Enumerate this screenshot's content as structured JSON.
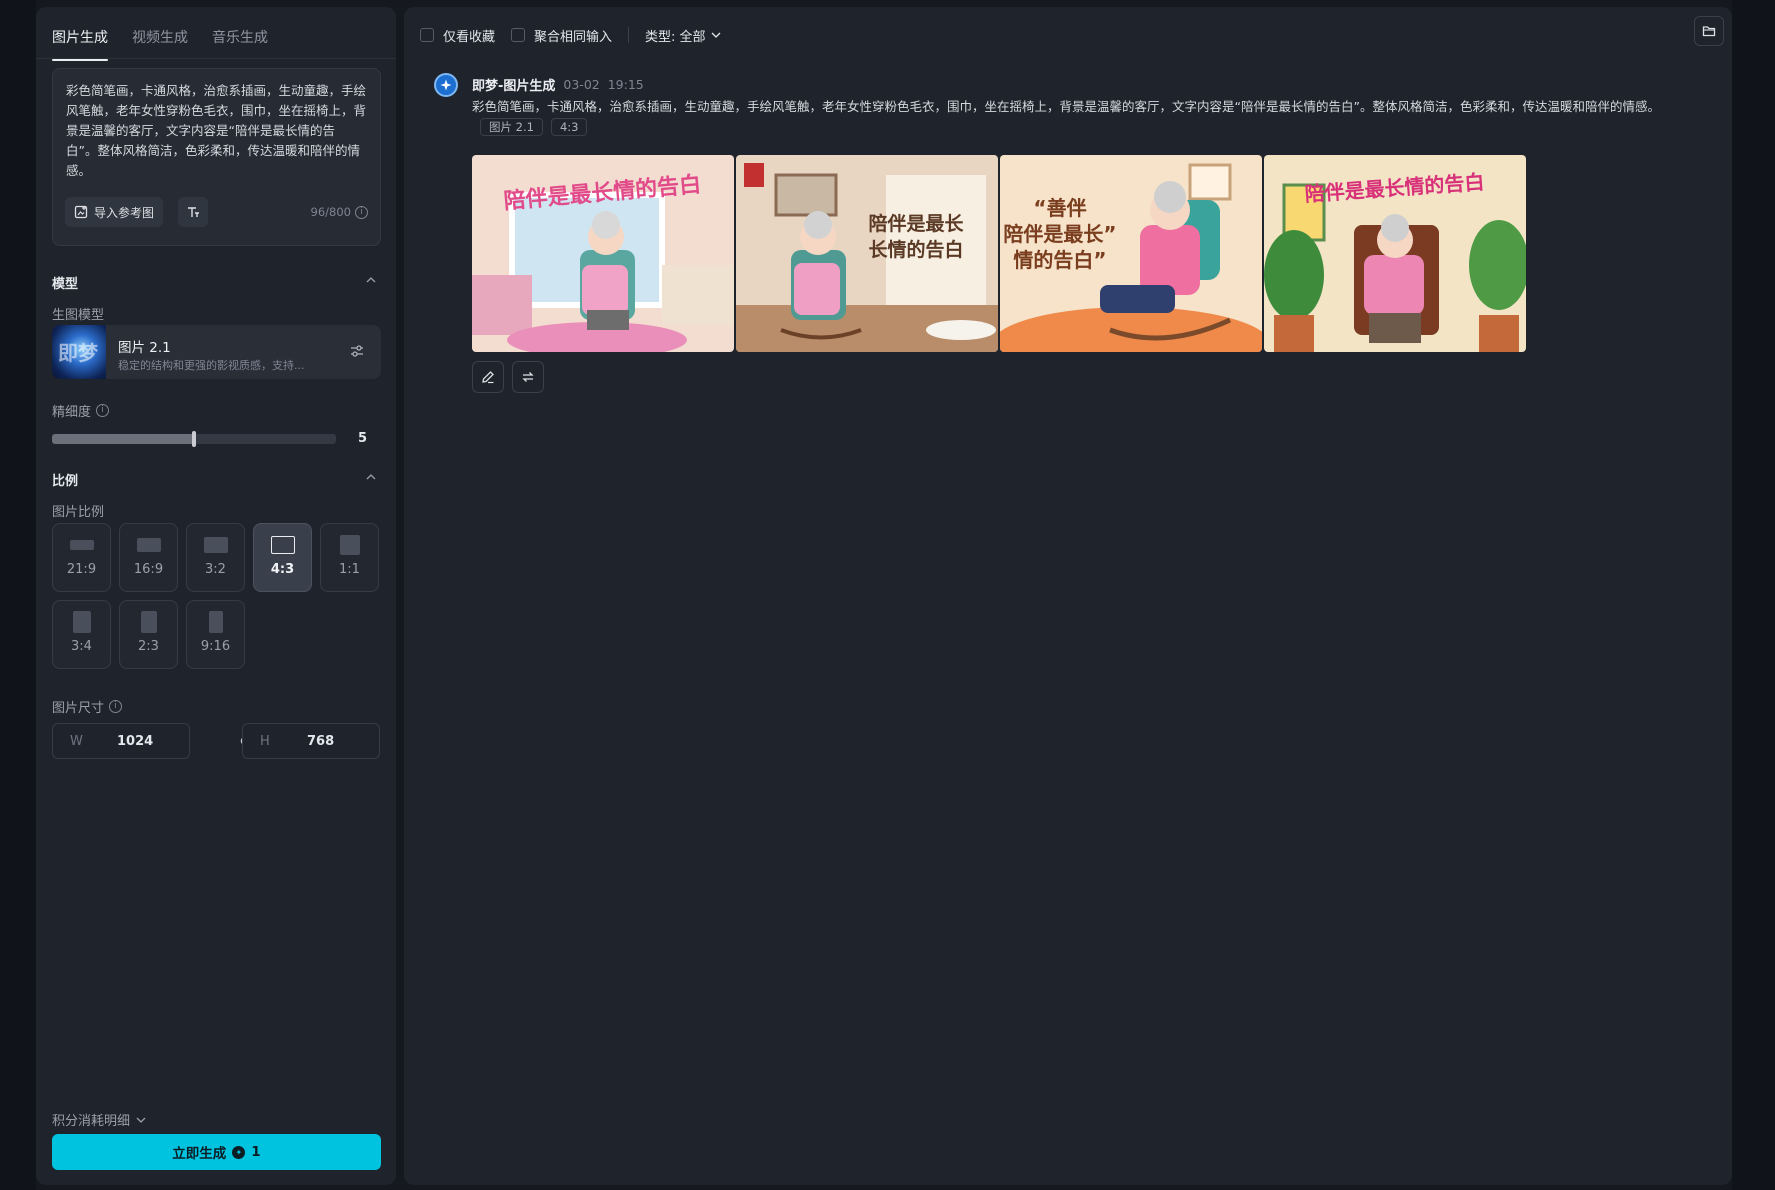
{
  "tabs": [
    {
      "label": "图片生成",
      "active": true
    },
    {
      "label": "视频生成",
      "active": false
    },
    {
      "label": "音乐生成",
      "active": false
    }
  ],
  "prompt": {
    "text": "彩色简笔画，卡通风格，治愈系插画，生动童趣，手绘风笔触，老年女性穿粉色毛衣，围巾，坐在摇椅上，背景是温馨的客厅，文字内容是“陪伴是最长情的告白”。整体风格简洁，色彩柔和，传达温暖和陪伴的情感。",
    "import_ref_label": "导入参考图",
    "char_count": "96/800"
  },
  "model_section": {
    "title": "模型",
    "sub_label": "生图模型",
    "model_name": "图片 2.1",
    "model_desc": "稳定的结构和更强的影视质感，支持...",
    "thumb_text": "即梦"
  },
  "fineness": {
    "label": "精细度",
    "value": "5",
    "level": 0.5
  },
  "ratio_section": {
    "title": "比例",
    "sub_label": "图片比例",
    "options": [
      "21:9",
      "16:9",
      "3:2",
      "4:3",
      "1:1",
      "3:4",
      "2:3",
      "9:16"
    ],
    "selected": "4:3"
  },
  "size": {
    "label": "图片尺寸",
    "w_key": "W",
    "w_value": "1024",
    "h_key": "H",
    "h_value": "768"
  },
  "cost_detail": "积分消耗明细",
  "generate": {
    "label": "立即生成",
    "cost": "1"
  },
  "toolbar": {
    "fav_only": "仅看收藏",
    "merge_same": "聚合相同输入",
    "type_filter": "类型: 全部"
  },
  "record": {
    "title": "即梦-图片生成",
    "date": "03-02",
    "time": "19:15",
    "prompt": "彩色简笔画，卡通风格，治愈系插画，生动童趣，手绘风笔触，老年女性穿粉色毛衣，围巾，坐在摇椅上，背景是温馨的客厅，文字内容是“陪伴是最长情的告白”。整体风格简洁，色彩柔和，传达温暖和陪伴的情感。",
    "tags": [
      "图片 2.1",
      "4:3"
    ],
    "images": [
      {
        "caption": "陪伴是最长情的告白",
        "bg": "#f2d9c8"
      },
      {
        "caption": "陪伴是最长 长情的告白",
        "bg": "#e9d7c2"
      },
      {
        "caption": "“善伴 陪伴是最长” 情的告白”",
        "bg": "#f5e1c8"
      },
      {
        "caption": "陪伴是最长情的告白",
        "bg": "#f1e3c3"
      }
    ]
  },
  "colors": {
    "accent": "#00c4df",
    "panel": "#1f232b",
    "background": "#15181e"
  }
}
